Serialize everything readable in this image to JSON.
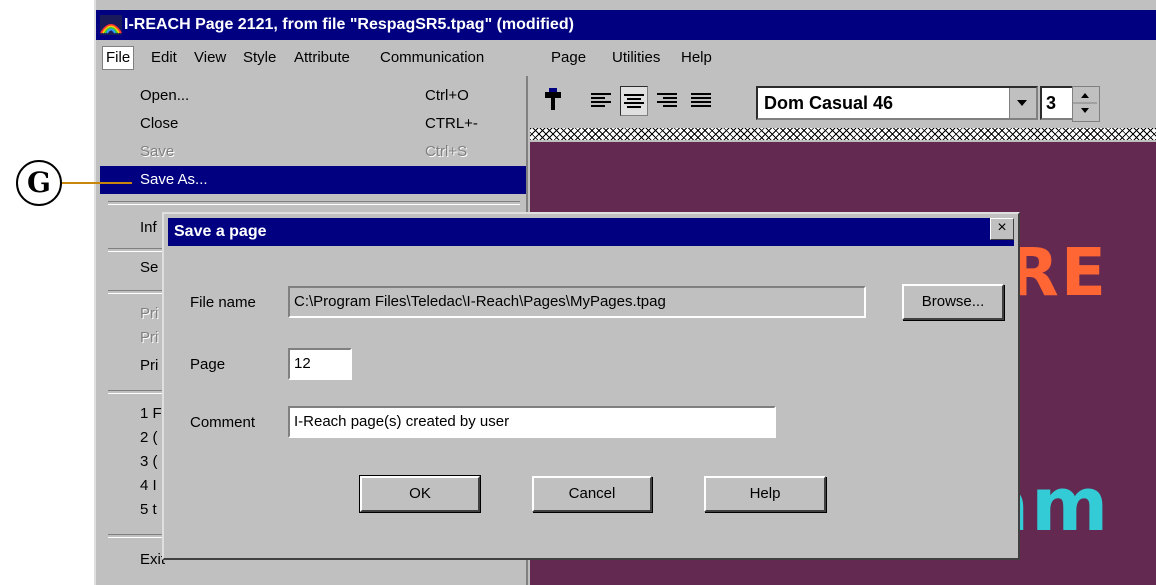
{
  "window": {
    "title": "I-REACH  Page 2121,  from file \"RespagSR5.tpag\"  (modified)"
  },
  "menubar": {
    "items": [
      "File",
      "Edit",
      "View",
      "Style",
      "Attribute",
      "Communication",
      "Page",
      "Utilities",
      "Help"
    ]
  },
  "toolbar": {
    "font": "Dom Casual 46",
    "size": "3"
  },
  "canvas": {
    "text_top": "RE",
    "text_bottom": "less program"
  },
  "file_menu": {
    "open": {
      "label": "Open...",
      "shortcut": "Ctrl+O"
    },
    "close": {
      "label": "Close",
      "shortcut": "CTRL+-"
    },
    "save": {
      "label": "Save",
      "shortcut": "Ctrl+S"
    },
    "save_as": {
      "label": "Save As..."
    },
    "partial": [
      "Inf",
      "Se",
      "Pri",
      "Pri",
      "Pri",
      "1 F",
      "2 (",
      "3 (",
      "4 I",
      "5 t"
    ],
    "exit": "Exit"
  },
  "callout": {
    "letter": "G"
  },
  "dialog": {
    "title": "Save a page",
    "close": "×",
    "file_name_label": "File name",
    "file_name_value": "C:\\Program Files\\Teledac\\I-Reach\\Pages\\MyPages.tpag",
    "browse_label": "Browse...",
    "page_label": "Page",
    "page_value": "12",
    "comment_label": "Comment",
    "comment_value": "I-Reach page(s) created by user",
    "ok_label": "OK",
    "cancel_label": "Cancel",
    "help_label": "Help"
  },
  "colors": {
    "titlebar": "#000080",
    "canvas": "#632950",
    "accent_orange": "#ff6633",
    "accent_cyan": "#33ccd6",
    "leader": "#c8860a"
  }
}
